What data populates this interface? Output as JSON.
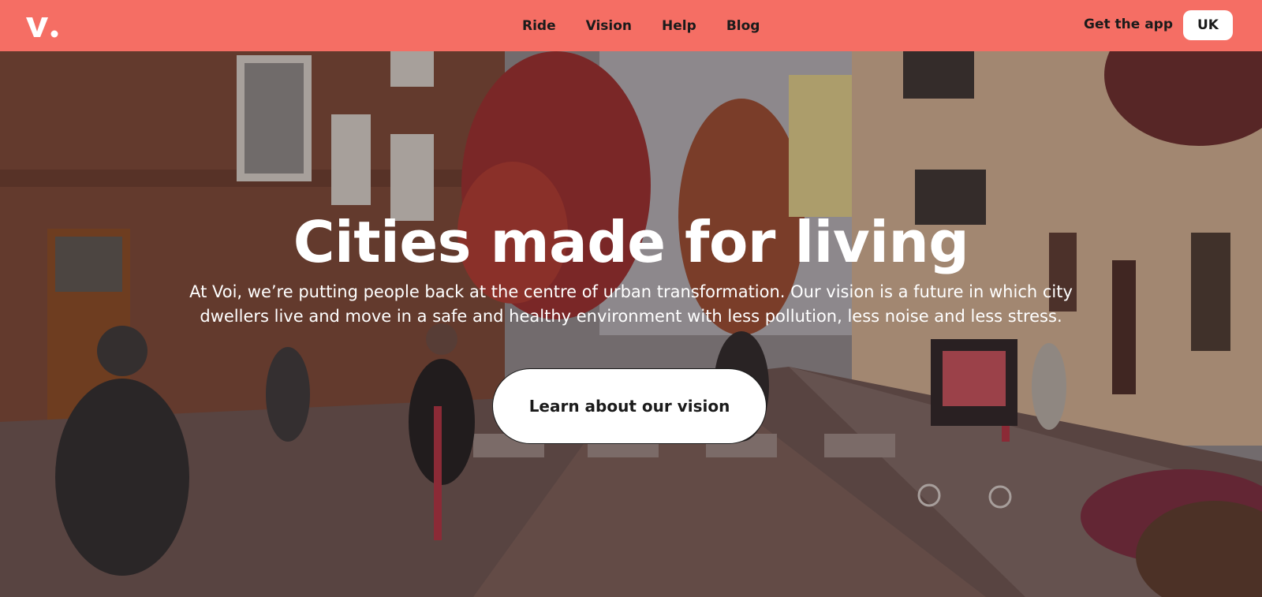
{
  "brand": {
    "logo_text": "V.",
    "accent": "#f56e64"
  },
  "nav": {
    "links": [
      "Ride",
      "Vision",
      "Help",
      "Blog"
    ],
    "get_app_label": "Get the app",
    "region_label": "UK"
  },
  "hero": {
    "title": "Cities made for living",
    "subtitle": "At Voi, we’re putting people back at the centre of urban transformation. Our vision is a future in which city dwellers live and move in a safe and healthy environment with less pollution, less noise and less stress.",
    "cta_label": "Learn about our vision",
    "background": "photo-street-scene"
  }
}
